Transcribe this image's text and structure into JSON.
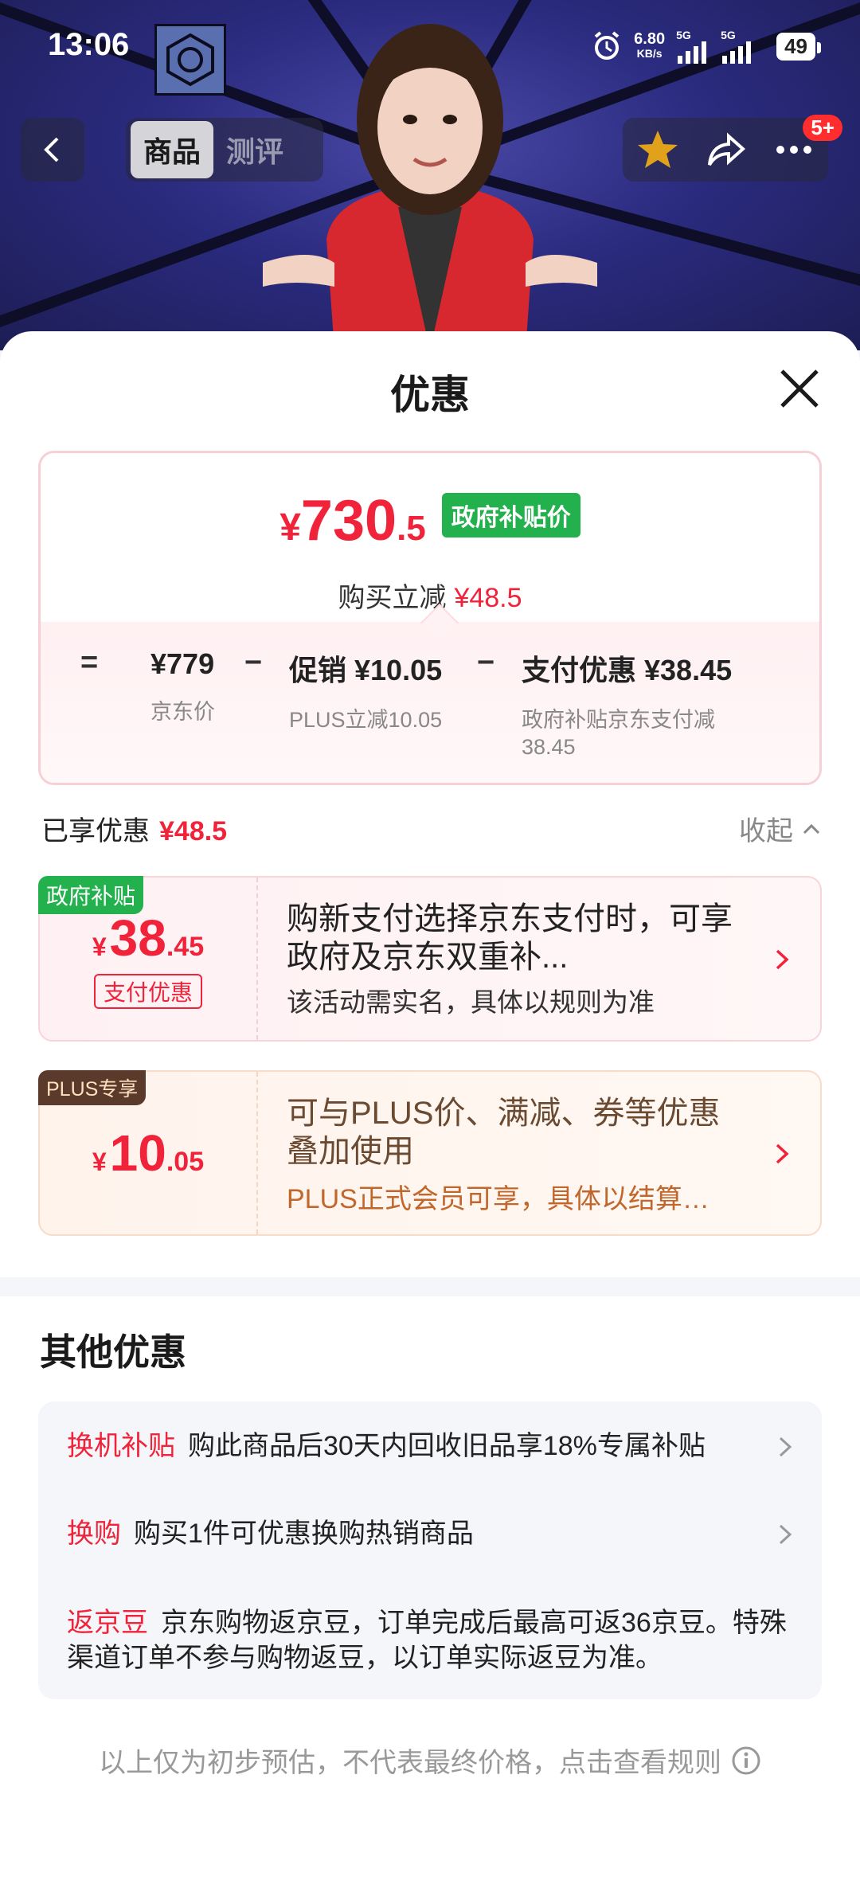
{
  "status_bar": {
    "time": "13:06",
    "net_speed": "6.80",
    "net_unit": "KB/s",
    "sig1": "5G",
    "sig2": "5G",
    "battery": "49"
  },
  "top_nav": {
    "tab_product": "商品",
    "tab_review": "测评",
    "badge": "5+"
  },
  "sheet": {
    "title": "优惠",
    "price": {
      "yen": "¥",
      "int": "730",
      "dec": ".5",
      "tag": "政府补贴价",
      "instant_label": "购买立减",
      "instant_value": "¥48.5"
    },
    "breakdown": {
      "eq": "=",
      "jd_price": "¥779",
      "jd_price_label": "京东价",
      "minus1": "−",
      "promo": "促销 ¥10.05",
      "promo_label": "PLUS立减10.05",
      "minus2": "−",
      "pay": "支付优惠 ¥38.45",
      "pay_label": "政府补贴京东支付减38.45"
    },
    "enjoyed_label": "已享优惠",
    "enjoyed_value": "¥48.5",
    "collapse_label": "收起",
    "promo1": {
      "tag": "政府补贴",
      "yen": "¥",
      "int": "38",
      "dec": ".45",
      "pay_tag": "支付优惠",
      "title": "购新支付选择京东支付时，可享政府及京东双重补...",
      "sub": "该活动需实名，具体以规则为准"
    },
    "promo2": {
      "tag": "PLUS专享",
      "yen": "¥",
      "int": "10",
      "dec": ".05",
      "title": "可与PLUS价、满减、券等优惠叠加使用",
      "sub": "PLUS正式会员可享，具体以结算…"
    },
    "other_title": "其他优惠",
    "other": [
      {
        "label": "换机补贴",
        "text": "购此商品后30天内回收旧品享18%专属补贴"
      },
      {
        "label": "换购",
        "text": "购买1件可优惠换购热销商品"
      },
      {
        "label": "返京豆",
        "text": "京东购物返京豆，订单完成后最高可返36京豆。特殊渠道订单不参与购物返豆，以订单实际返豆为准。"
      }
    ],
    "footer": "以上仅为初步预估，不代表最终价格，点击查看规则"
  },
  "colors": {
    "accent_red": "#f0233a",
    "subsidy_green": "#22b14c",
    "plus_brown": "#5a3a2a"
  }
}
